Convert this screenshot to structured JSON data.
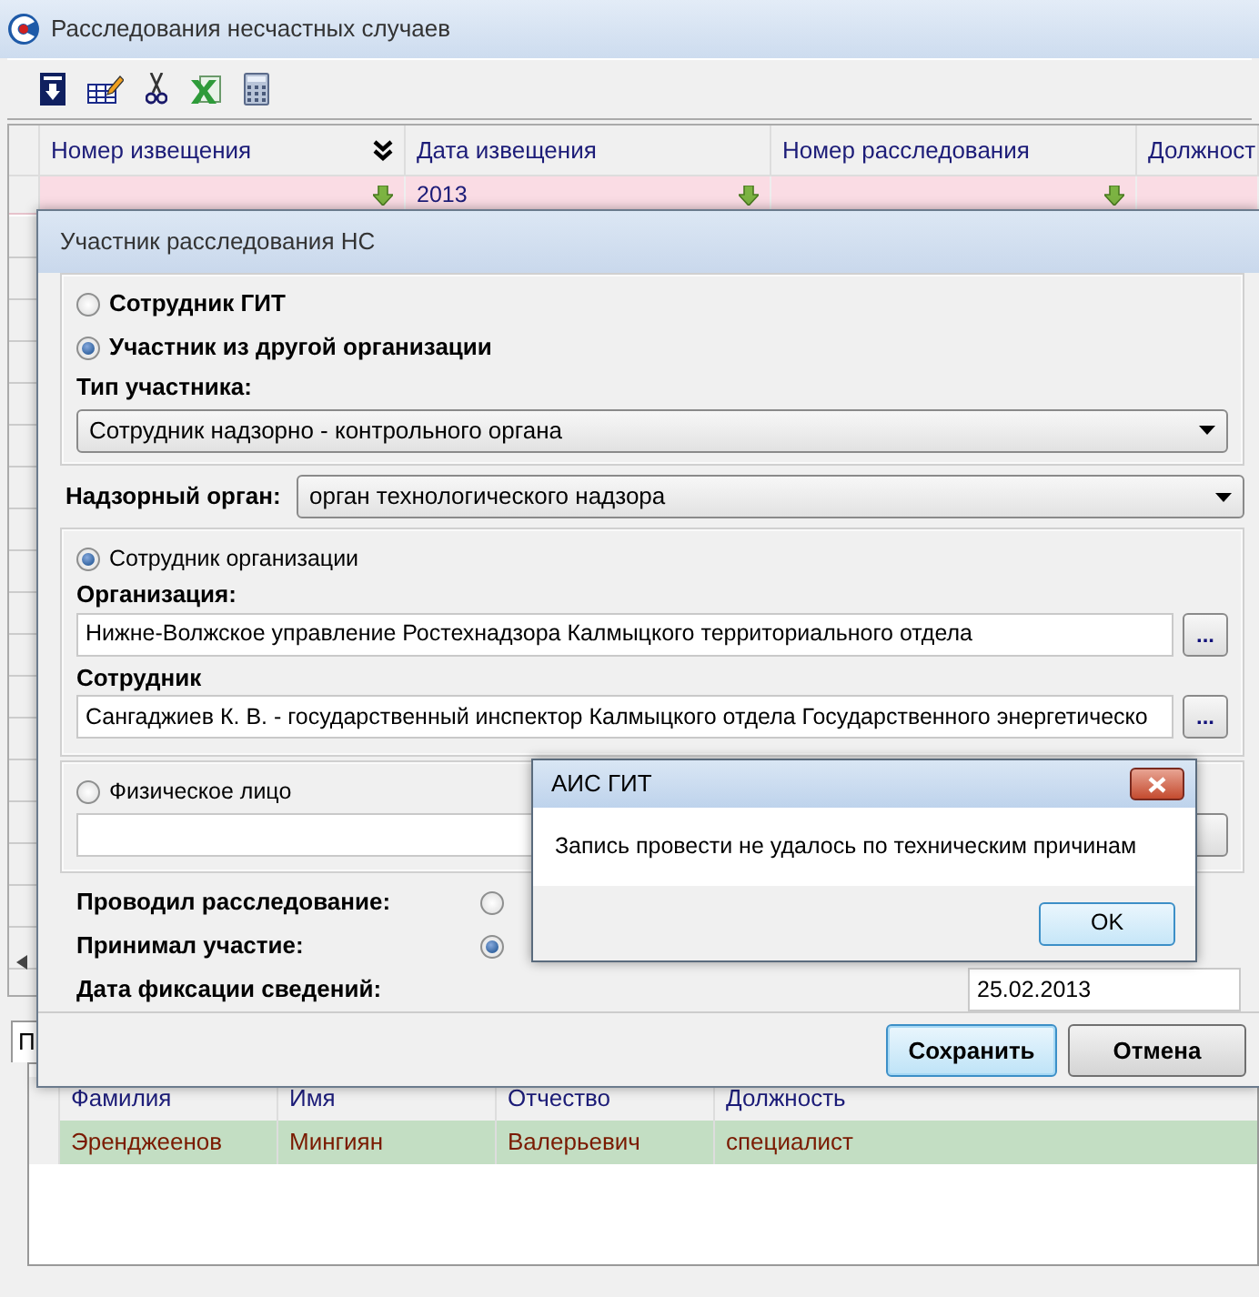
{
  "window": {
    "title": "Расследования несчастных случаев"
  },
  "toolbar": [
    {
      "kind": "download"
    },
    {
      "kind": "edit"
    },
    {
      "kind": "cut"
    },
    {
      "kind": "excel"
    },
    {
      "kind": "calculator"
    }
  ],
  "grid": {
    "columns": [
      {
        "label": "Номер извещения",
        "expand": true
      },
      {
        "label": "Дата извещения",
        "expand": false
      },
      {
        "label": "Номер расследования",
        "expand": false
      },
      {
        "label": "Должност"
      }
    ],
    "filter_row": [
      {
        "filter": true
      },
      {
        "value": "2013",
        "filter": true
      },
      {
        "filter": true
      }
    ]
  },
  "dialog": {
    "title": "Участник расследования НС",
    "source_options": [
      {
        "label": "Сотрудник ГИТ",
        "selected": false
      },
      {
        "label": "Участник из другой организации",
        "selected": true
      }
    ],
    "participant_type": {
      "label": "Тип участника:",
      "value": "Сотрудник надзорно - контрольного органа"
    },
    "supervisory_body": {
      "label": "Надзорный орган:",
      "value": "орган технологического надзора"
    },
    "organization_employee": {
      "label": "Сотрудник организации",
      "selected": true,
      "organization_label": "Организация:",
      "organization": "Нижне-Волжское управление Ростехнадзора Калмыцкого территориального отдела",
      "organization_button": "...",
      "employee_label": "Сотрудник",
      "employee": "Сангаджиев К. В. - государственный инспектор Калмыцкого отдела Государственного энергетическо",
      "employee_button": "..."
    },
    "individual": {
      "label": "Физическое лицо",
      "selected": false
    },
    "roles": [
      {
        "label": "Проводил расследование:",
        "selected": false
      },
      {
        "label": "Принимал участие:",
        "selected": true
      }
    ],
    "date": {
      "label": "Дата фиксации сведений:",
      "value": "25.02.2013"
    },
    "buttons": [
      {
        "label": "Сохранить",
        "default": true
      },
      {
        "label": "Отмена",
        "default": false
      }
    ]
  },
  "message_box": {
    "title": "АИС ГИТ",
    "text": "Запись провести не удалось по техническим причинам",
    "button": "OK"
  },
  "detail_tab": {
    "label": "П"
  },
  "detail_grid": {
    "columns": [
      "Фамилия",
      "Имя",
      "Отчество",
      "Должность"
    ],
    "rows": [
      {
        "cells": [
          "Эренджеенов",
          "Мингиян",
          "Валерьевич",
          "специалист"
        ],
        "selected": true
      }
    ]
  }
}
